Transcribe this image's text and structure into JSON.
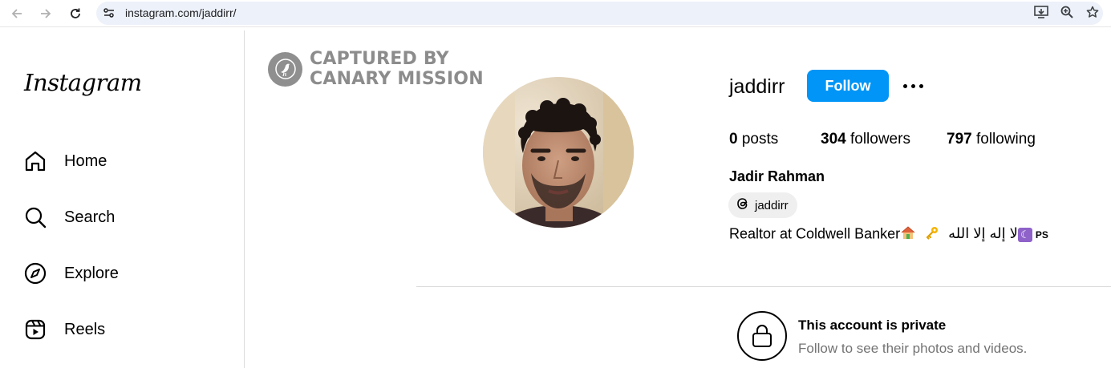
{
  "browser": {
    "url": "instagram.com/jaddirr/",
    "icons": [
      "back-arrow-icon",
      "forward-arrow-icon",
      "reload-icon",
      "site-settings-icon",
      "install-app-icon",
      "zoom-icon",
      "bookmark-star-icon"
    ]
  },
  "sidebar": {
    "logo": "Instagram",
    "items": [
      {
        "label": "Home",
        "icon": "home-icon"
      },
      {
        "label": "Search",
        "icon": "search-icon"
      },
      {
        "label": "Explore",
        "icon": "compass-icon"
      },
      {
        "label": "Reels",
        "icon": "reels-icon"
      }
    ]
  },
  "watermark": {
    "line1": "CAPTURED BY",
    "line2": "CANARY MISSION"
  },
  "profile": {
    "username": "jaddirr",
    "follow_label": "Follow",
    "posts_count": "0",
    "posts_label": "posts",
    "followers_count": "304",
    "followers_label": "followers",
    "following_count": "797",
    "following_label": "following",
    "full_name": "Jadir Rahman",
    "threads_handle": "jaddirr",
    "bio_text": "Realtor at Coldwell Banker",
    "bio_arabic": "لا إله إلا الله",
    "bio_ps": "PS"
  },
  "private": {
    "title": "This account is private",
    "subtitle": "Follow to see their photos and videos."
  },
  "colors": {
    "follow_blue": "#0095f6",
    "watermark_gray": "#8c8c8c",
    "url_bar_bg": "#edf1f9"
  }
}
